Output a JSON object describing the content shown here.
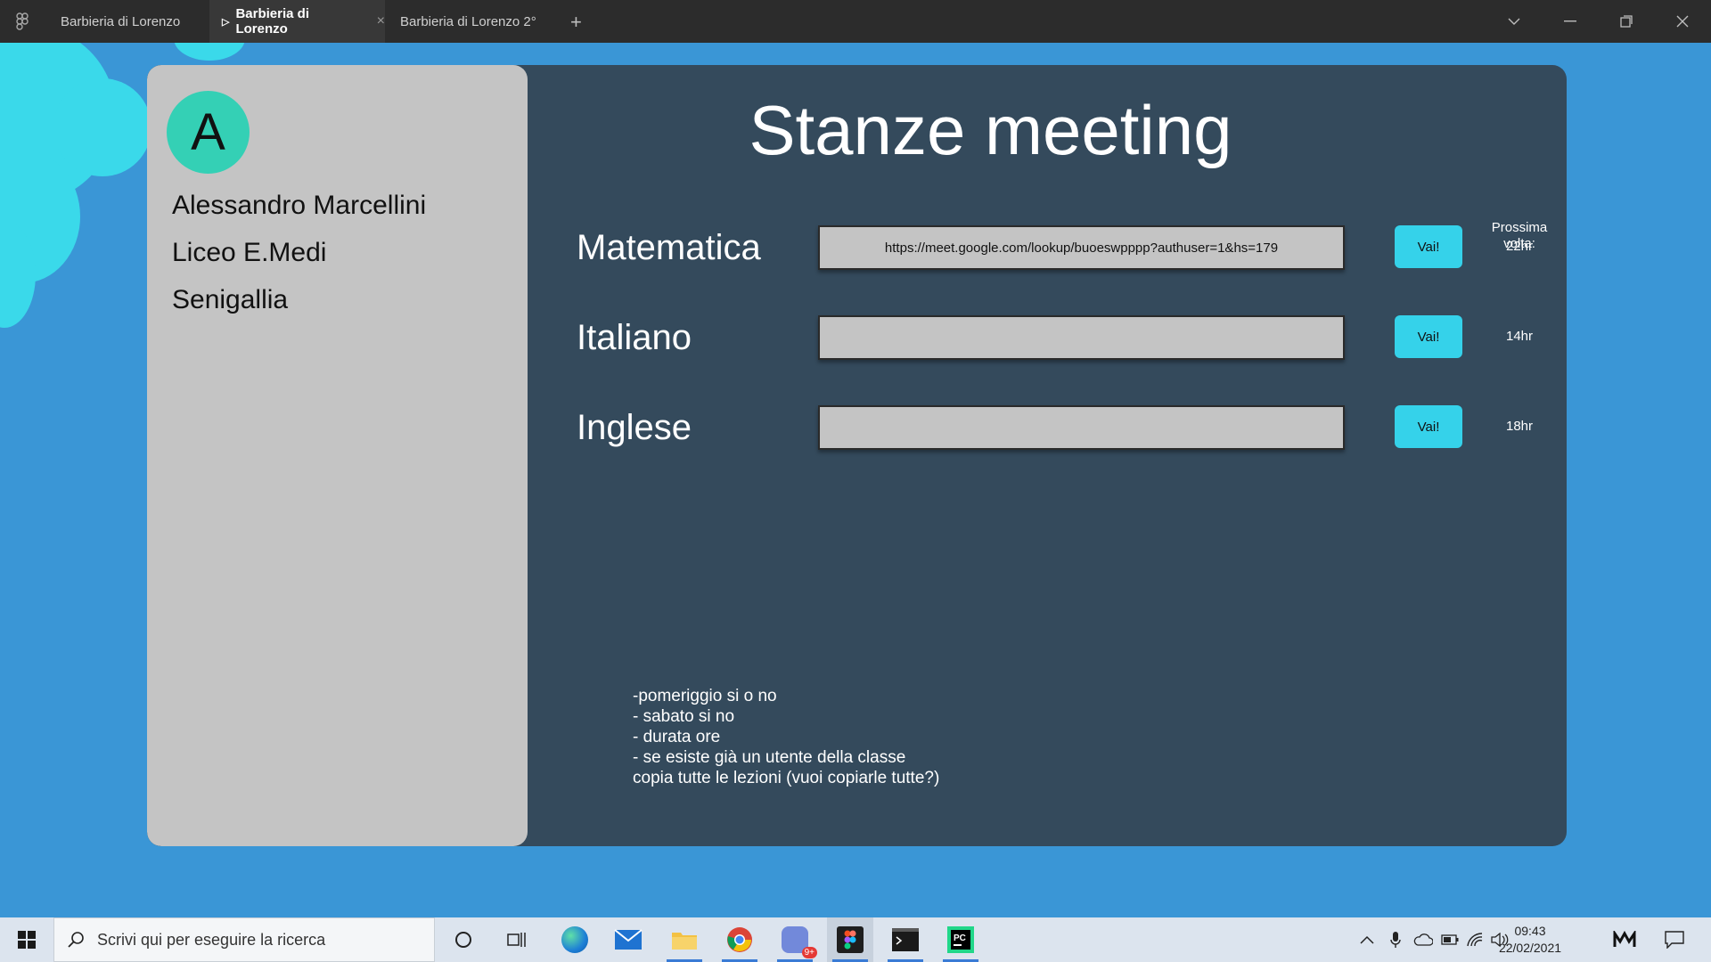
{
  "window": {
    "tabs": [
      {
        "label": "Barbieria di Lorenzo"
      },
      {
        "label": "Barbieria di Lorenzo"
      },
      {
        "label": "Barbieria di Lorenzo 2°"
      }
    ]
  },
  "profile": {
    "avatar_letter": "A",
    "name": "Alessandro Marcellini",
    "school": "Liceo E.Medi",
    "city": "Senigallia"
  },
  "page": {
    "title": "Stanze meeting",
    "next_label": "Prossima volta:"
  },
  "rooms": [
    {
      "name": "Matematica",
      "link": "https://meet.google.com/lookup/buoeswpppp?authuser=1&hs=179",
      "button": "Vai!",
      "next": "22hr"
    },
    {
      "name": "Italiano",
      "link": "",
      "button": "Vai!",
      "next": "14hr"
    },
    {
      "name": "Inglese",
      "link": "",
      "button": "Vai!",
      "next": "18hr"
    }
  ],
  "notes": [
    " -pomeriggio si o no",
    "- sabato si no",
    "- durata ore",
    "- se esiste già un utente della classe",
    "copia tutte le lezioni (vuoi copiarle tutte?)"
  ],
  "taskbar": {
    "search_placeholder": "Scrivi qui per eseguire la ricerca",
    "badge": "9+",
    "time": "09:43",
    "date": "22/02/2021"
  },
  "colors": {
    "canvas": "#3a96d6",
    "card": "#344a5c",
    "sidebar": "#c4c4c4",
    "accent": "#35d2ea",
    "avatar": "#34d0b5"
  }
}
